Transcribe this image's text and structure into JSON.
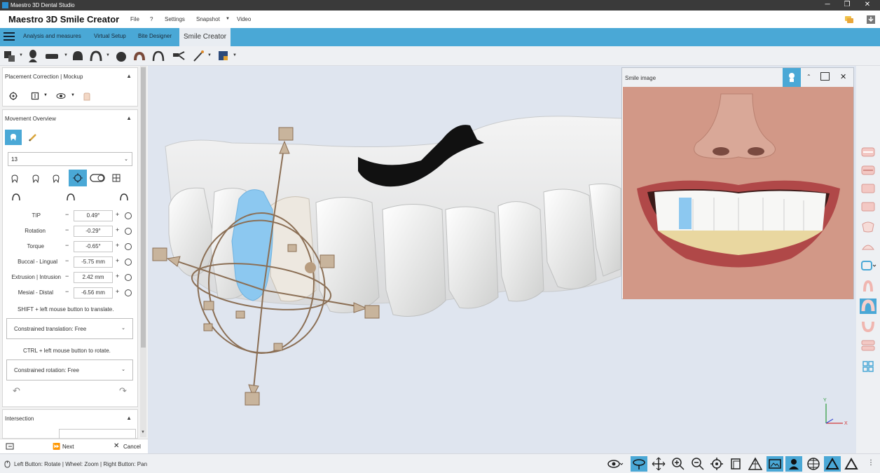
{
  "window": {
    "title": "Maestro 3D Dental Studio",
    "minimize": "─",
    "maximize": "❐",
    "close": "✕"
  },
  "menubar": {
    "brand": "Maestro 3D Smile Creator",
    "items": [
      "File",
      "?",
      "Settings",
      "Snapshot",
      "Video"
    ]
  },
  "tabs": [
    {
      "label": "Analysis and measures"
    },
    {
      "label": "Virtual Setup"
    },
    {
      "label": "Bite Designer"
    },
    {
      "label": "Smile Creator",
      "active": true
    }
  ],
  "left_panel": {
    "placement": {
      "title": "Placement Correction | Mockup"
    },
    "movement": {
      "title": "Movement Overview",
      "tooth_select": "13",
      "params": [
        {
          "label": "TIP",
          "value": "0.49°"
        },
        {
          "label": "Rotation",
          "value": "-0.29°"
        },
        {
          "label": "Torque",
          "value": "-0.65°"
        },
        {
          "label": "Buccal - Lingual",
          "value": "-5.75 mm"
        },
        {
          "label": "Extrusion | Intrusion",
          "value": "2.42 mm"
        },
        {
          "label": "Mesial - Distal",
          "value": "-6.56 mm"
        }
      ],
      "minus": "−",
      "plus": "+",
      "translate_hint": "SHIFT + left mouse button to translate.",
      "translation_dropdown": "Constrained translation: Free",
      "rotate_hint": "CTRL + left mouse button to rotate.",
      "rotation_dropdown": "Constrained rotation: Free",
      "undo": "↶",
      "redo": "↷"
    },
    "intersection": {
      "title": "Intersection"
    },
    "next_label": "Next",
    "cancel_label": "Cancel"
  },
  "smile_window": {
    "title": "Smile image"
  },
  "axis_labels": {
    "x": "X",
    "y": "Y"
  },
  "status_bar": {
    "hint": "Left Button: Rotate | Wheel: Zoom | Right Button: Pan"
  },
  "colors": {
    "accent": "#4aa8d6",
    "selected_tooth": "#8cc8f0",
    "gizmo": "#b59a7c"
  }
}
